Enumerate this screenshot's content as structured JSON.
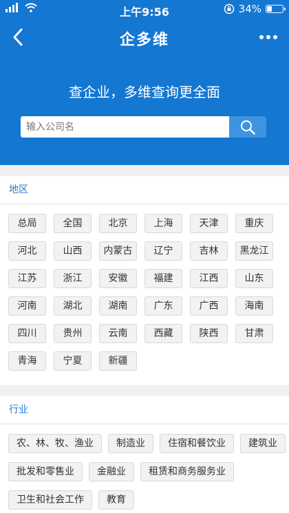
{
  "status_bar": {
    "time": "上午9:56",
    "battery_text": "34%",
    "battery_level": 0.34
  },
  "nav": {
    "title": "企多维"
  },
  "hero": {
    "slogan": "查企业，多维查询更全面"
  },
  "search": {
    "placeholder": "输入公司名"
  },
  "region": {
    "title": "地区",
    "items": [
      "总局",
      "全国",
      "北京",
      "上海",
      "天津",
      "重庆",
      "河北",
      "山西",
      "内蒙古",
      "辽宁",
      "吉林",
      "黑龙江",
      "江苏",
      "浙江",
      "安徽",
      "福建",
      "江西",
      "山东",
      "河南",
      "湖北",
      "湖南",
      "广东",
      "广西",
      "海南",
      "四川",
      "贵州",
      "云南",
      "西藏",
      "陕西",
      "甘肃",
      "青海",
      "宁夏",
      "新疆"
    ]
  },
  "industry": {
    "title": "行业",
    "items": [
      "农、林、牧、渔业",
      "制造业",
      "住宿和餐饮业",
      "建筑业",
      "批发和零售业",
      "金融业",
      "租赁和商务服务业",
      "卫生和社会工作",
      "教育"
    ]
  },
  "colors": {
    "header_blue": "#1477d2",
    "search_button": "#3d94e0",
    "section_title": "#1e7bd0"
  },
  "icons": [
    "signal-icon",
    "wifi-icon",
    "rotation-lock-icon",
    "battery-icon",
    "back-arrow-icon",
    "more-icon",
    "search-icon"
  ]
}
